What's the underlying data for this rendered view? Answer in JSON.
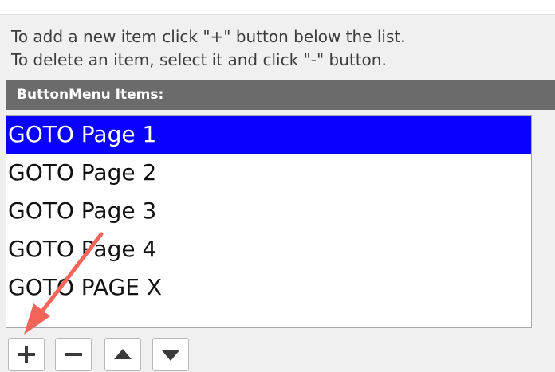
{
  "instructions": {
    "line1": "To add a new item click \"+\" button below the list.",
    "line2": "To delete an item, select it and click \"-\" button."
  },
  "list": {
    "header": "ButtonMenu Items:",
    "items": [
      {
        "label": "GOTO Page 1",
        "selected": true
      },
      {
        "label": "GOTO Page 2",
        "selected": false
      },
      {
        "label": "GOTO Page 3",
        "selected": false
      },
      {
        "label": "GOTO Page 4",
        "selected": false
      },
      {
        "label": "GOTO PAGE X",
        "selected": false
      }
    ]
  },
  "toolbar": {
    "buttons": [
      {
        "icon": "plus-icon"
      },
      {
        "icon": "minus-icon"
      },
      {
        "icon": "move-up-icon"
      },
      {
        "icon": "move-down-icon"
      }
    ]
  },
  "colors": {
    "selection": "#0a00ff",
    "header_bg": "#6b6b6b",
    "annotation_arrow": "#f2665a"
  }
}
